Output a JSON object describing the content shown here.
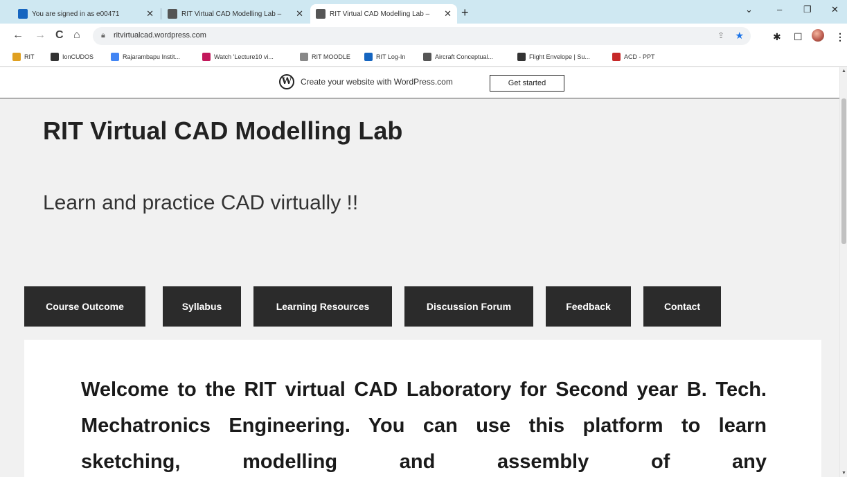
{
  "browser": {
    "tabs": [
      {
        "title": "You are signed in as e00471",
        "favicon_color": "#1565c0"
      },
      {
        "title": "RIT Virtual CAD Modelling Lab –",
        "favicon_color": "#555555"
      },
      {
        "title": "RIT Virtual CAD Modelling Lab –",
        "favicon_color": "#555555"
      }
    ],
    "active_tab_index": 2,
    "new_tab": "+",
    "window_controls": {
      "dropdown": "⌄",
      "minimize": "–",
      "restore": "❐",
      "close": "✕"
    },
    "nav": {
      "back": "←",
      "forward": "→",
      "reload": "C",
      "home": "⌂"
    },
    "url": "ritvirtualcad.wordpress.com",
    "bookmarks": [
      {
        "label": "RIT",
        "icon_color": "#e0a020"
      },
      {
        "label": "IonCUDOS",
        "icon_color": "#333333"
      },
      {
        "label": "Rajarambapu Instit...",
        "icon_color": "#4285f4"
      },
      {
        "label": "Watch 'Lecture10 vi...",
        "icon_color": "#c2185b"
      },
      {
        "label": "RIT MOODLE",
        "icon_color": "#888888"
      },
      {
        "label": "RIT Log-In",
        "icon_color": "#1565c0"
      },
      {
        "label": "Aircraft Conceptual...",
        "icon_color": "#555555"
      },
      {
        "label": "Flight Envelope | Su...",
        "icon_color": "#333333"
      },
      {
        "label": "ACD - PPT",
        "icon_color": "#c62828"
      }
    ]
  },
  "wp_banner": {
    "text": "Create your website with WordPress.com",
    "button": "Get started"
  },
  "site": {
    "title": "RIT Virtual CAD Modelling Lab",
    "tagline": "Learn and practice CAD virtually !!"
  },
  "nav_menu": [
    "Course Outcome",
    "Syllabus",
    "Learning Resources",
    "Discussion Forum",
    "Feedback",
    "Contact"
  ],
  "content": {
    "welcome": "Welcome to the RIT virtual CAD Laboratory for Second year B. Tech. Mechatronics Engineering. You can use this platform to learn sketching, modelling and assembly of any"
  }
}
